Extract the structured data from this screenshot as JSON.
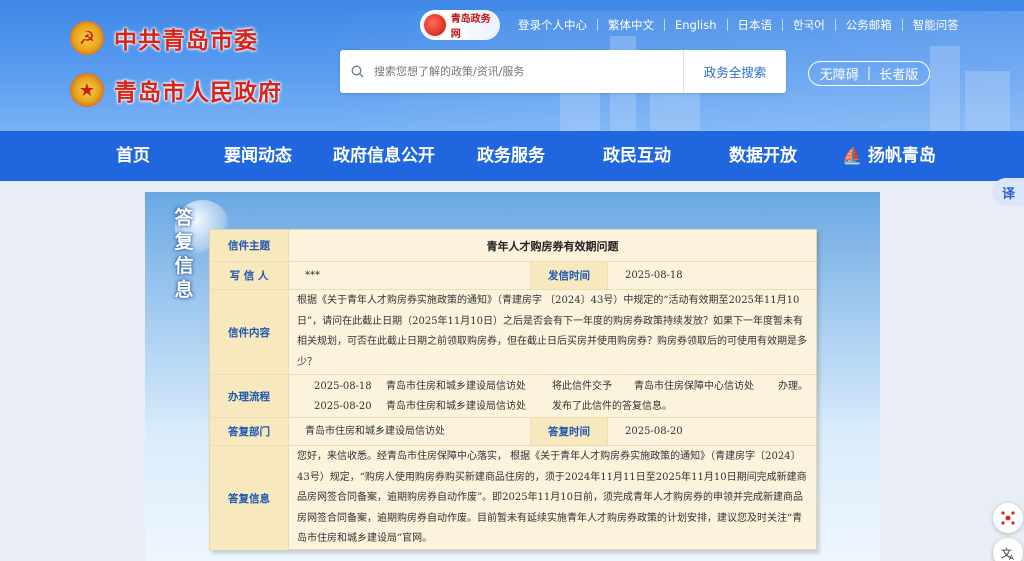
{
  "header": {
    "party_title": "中共青岛市委",
    "gov_title": "青岛市人民政府",
    "site_badge": "青岛政务网",
    "top_links": [
      "登录个人中心",
      "繁体中文",
      "English",
      "日本语",
      "한국어",
      "公务邮箱",
      "智能问答"
    ],
    "search_placeholder": "搜索您想了解的政策/资讯/服务",
    "search_button": "政务全搜索",
    "accessibility": "无障碍",
    "elder": "长者版"
  },
  "nav": [
    "首页",
    "要闻动态",
    "政府信息公开",
    "政务服务",
    "政民互动",
    "数据开放",
    "扬帆青岛"
  ],
  "side_title": "答复信息",
  "letter": {
    "subject_label": "信件主题",
    "subject": "青年人才购房券有效期问题",
    "writer_label": "写 信 人",
    "writer": "***",
    "sent_label": "发信时间",
    "sent_date": "2025-08-18",
    "content_label": "信件内容",
    "content": "根据《关于青年人才购房券实施政策的通知》（青建房字 〔2024〕43号）中规定的“活动有效期至2025年11月10日”，请问在此截止日期（2025年11月10日）之后是否会有下一年度的购房券政策持续发放？如果下一年度暂未有相关规划，可否在此截止日期之前领取购房券，但在截止日后买房并使用购房券？购房券领取后的可使用有效期是多少？",
    "process_label": "办理流程",
    "process": [
      {
        "date": "2025-08-18",
        "dept": "青岛市住房和城乡建设局信访处",
        "action": "将此信件交予",
        "target": "青岛市住房保障中心信访处",
        "end": "办理。"
      },
      {
        "date": "2025-08-20",
        "dept": "青岛市住房和城乡建设局信访处",
        "action": "发布了此信件的答复信息。",
        "target": "",
        "end": ""
      }
    ],
    "reply_dept_label": "答复部门",
    "reply_dept": "青岛市住房和城乡建设局信访处",
    "reply_time_label": "答复时间",
    "reply_date": "2025-08-20",
    "reply_label": "答复信息",
    "reply": "您好，来信收悉。经青岛市住房保障中心落实， 根据《关于青年人才购房券实施政策的通知》（青建房字〔2024〕43号）规定，“购房人使用购房券购买新建商品住房的，须于2024年11月11日至2025年11月10日期间完成新建商品房网签合同备案，逾期购房券自动作废”。即2025年11月10日前，须完成青年人才购房券的申领并完成新建商品房网签合同备案，逾期购房券自动作废。目前暂未有延续实施青年人才购房券政策的计划安排，建议您及时关注“青岛市住房和城乡建设局”官网。"
  },
  "widgets": {
    "translate": "译"
  }
}
